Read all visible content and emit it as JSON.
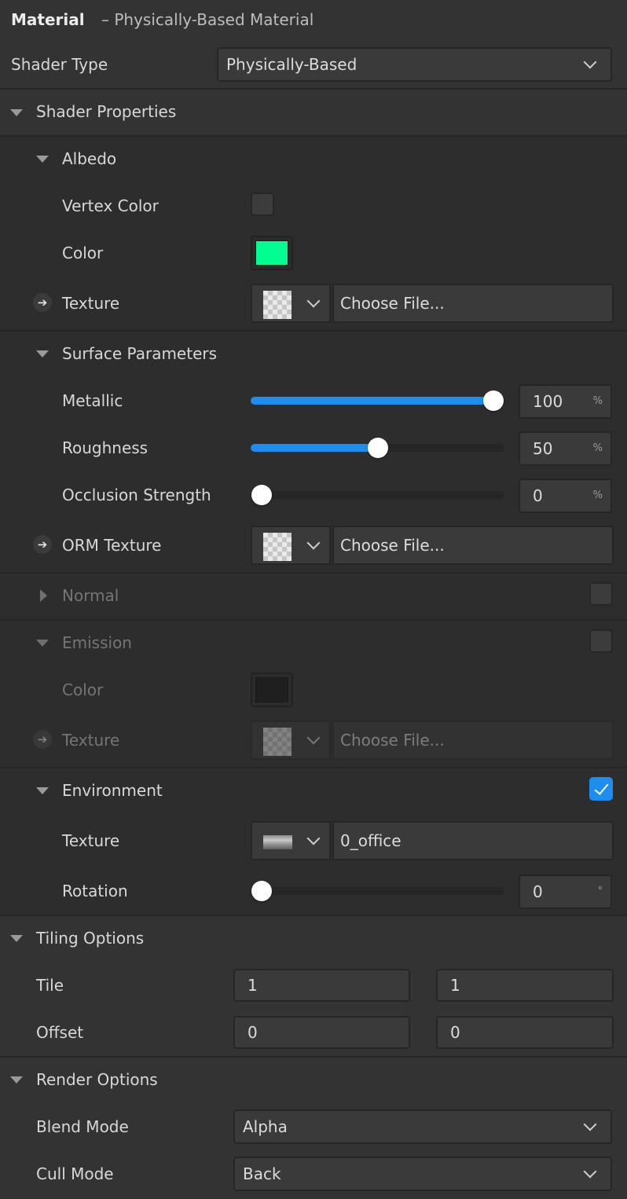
{
  "header": {
    "title": "Material",
    "subtitle": "– Physically-Based Material"
  },
  "shader_type": {
    "label": "Shader Type",
    "value": "Physically-Based"
  },
  "shader_properties": {
    "label": "Shader Properties"
  },
  "albedo": {
    "label": "Albedo",
    "vertex_color_label": "Vertex Color",
    "vertex_color_checked": false,
    "color_label": "Color",
    "color_value": "#00ff90",
    "texture_label": "Texture",
    "texture_value": "Choose File..."
  },
  "surface": {
    "label": "Surface Parameters",
    "metallic": {
      "label": "Metallic",
      "value": "100",
      "unit": "%",
      "fraction": 1.0
    },
    "roughness": {
      "label": "Roughness",
      "value": "50",
      "unit": "%",
      "fraction": 0.5
    },
    "occlusion": {
      "label": "Occlusion Strength",
      "value": "0",
      "unit": "%",
      "fraction": 0.0
    },
    "orm_label": "ORM Texture",
    "orm_value": "Choose File..."
  },
  "normal": {
    "label": "Normal",
    "enabled": false
  },
  "emission": {
    "label": "Emission",
    "enabled": false,
    "color_label": "Color",
    "color_value": "#1f1f1f",
    "texture_label": "Texture",
    "texture_value": "Choose File..."
  },
  "environment": {
    "label": "Environment",
    "enabled": true,
    "texture_label": "Texture",
    "texture_value": "0_office",
    "rotation": {
      "label": "Rotation",
      "value": "0",
      "unit": "°",
      "fraction": 0.0
    }
  },
  "tiling": {
    "label": "Tiling Options",
    "tile_label": "Tile",
    "tile_x": "1",
    "tile_y": "1",
    "offset_label": "Offset",
    "offset_x": "0",
    "offset_y": "0"
  },
  "render": {
    "label": "Render Options",
    "blend_label": "Blend Mode",
    "blend_value": "Alpha",
    "cull_label": "Cull Mode",
    "cull_value": "Back"
  },
  "colors": {
    "accent": "#1d8df0",
    "panel": "#333333",
    "section": "#2d2d2d"
  }
}
